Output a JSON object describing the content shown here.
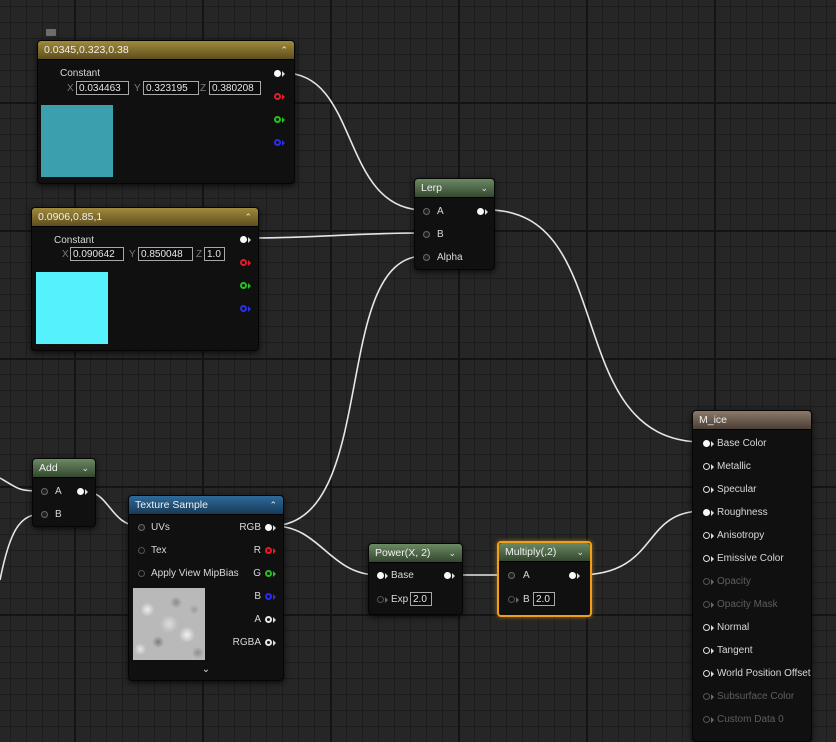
{
  "const1": {
    "title": "0.0345,0.323,0.38",
    "label": "Constant",
    "x": "0.034463",
    "y": "0.323195",
    "z": "0.380208",
    "color": "#3b9fae"
  },
  "const2": {
    "title": "0.0906,0.85,1",
    "label": "Constant",
    "x": "0.090642",
    "y": "0.850048",
    "z": "1.0",
    "color": "#55f1fd"
  },
  "axes": {
    "x": "X",
    "y": "Y",
    "z": "Z"
  },
  "lerp": {
    "title": "Lerp",
    "pins": [
      "A",
      "B",
      "Alpha"
    ]
  },
  "add": {
    "title": "Add",
    "pins": [
      "A",
      "B"
    ]
  },
  "texture": {
    "title": "Texture Sample",
    "inputs": [
      "UVs",
      "Tex",
      "Apply View MipBias"
    ],
    "outputs": [
      "RGB",
      "R",
      "G",
      "B",
      "A",
      "RGBA"
    ]
  },
  "power": {
    "title": "Power(X, 2)",
    "base": "Base",
    "exp": "Exp",
    "exp_value": "2.0"
  },
  "multiply": {
    "title": "Multiply(,2)",
    "a": "A",
    "b": "B",
    "b_value": "2.0"
  },
  "material": {
    "title": "M_ice",
    "inputs": [
      {
        "label": "Base Color",
        "connected": true,
        "enabled": true
      },
      {
        "label": "Metallic",
        "connected": false,
        "enabled": true
      },
      {
        "label": "Specular",
        "connected": false,
        "enabled": true
      },
      {
        "label": "Roughness",
        "connected": true,
        "enabled": true
      },
      {
        "label": "Anisotropy",
        "connected": false,
        "enabled": true
      },
      {
        "label": "Emissive Color",
        "connected": false,
        "enabled": true
      },
      {
        "label": "Opacity",
        "connected": false,
        "enabled": false
      },
      {
        "label": "Opacity Mask",
        "connected": false,
        "enabled": false
      },
      {
        "label": "Normal",
        "connected": false,
        "enabled": true
      },
      {
        "label": "Tangent",
        "connected": false,
        "enabled": true
      },
      {
        "label": "World Position Offset",
        "connected": false,
        "enabled": true
      },
      {
        "label": "Subsurface Color",
        "connected": false,
        "enabled": false
      },
      {
        "label": "Custom Data 0",
        "connected": false,
        "enabled": false
      }
    ]
  },
  "icons": {
    "collapse": "chevron-up-icon",
    "expand": "chevron-down-icon",
    "comment": "comment-bubble-icon",
    "chevron_up_glyph": "⌃",
    "chevron_down_glyph": "⌄"
  }
}
